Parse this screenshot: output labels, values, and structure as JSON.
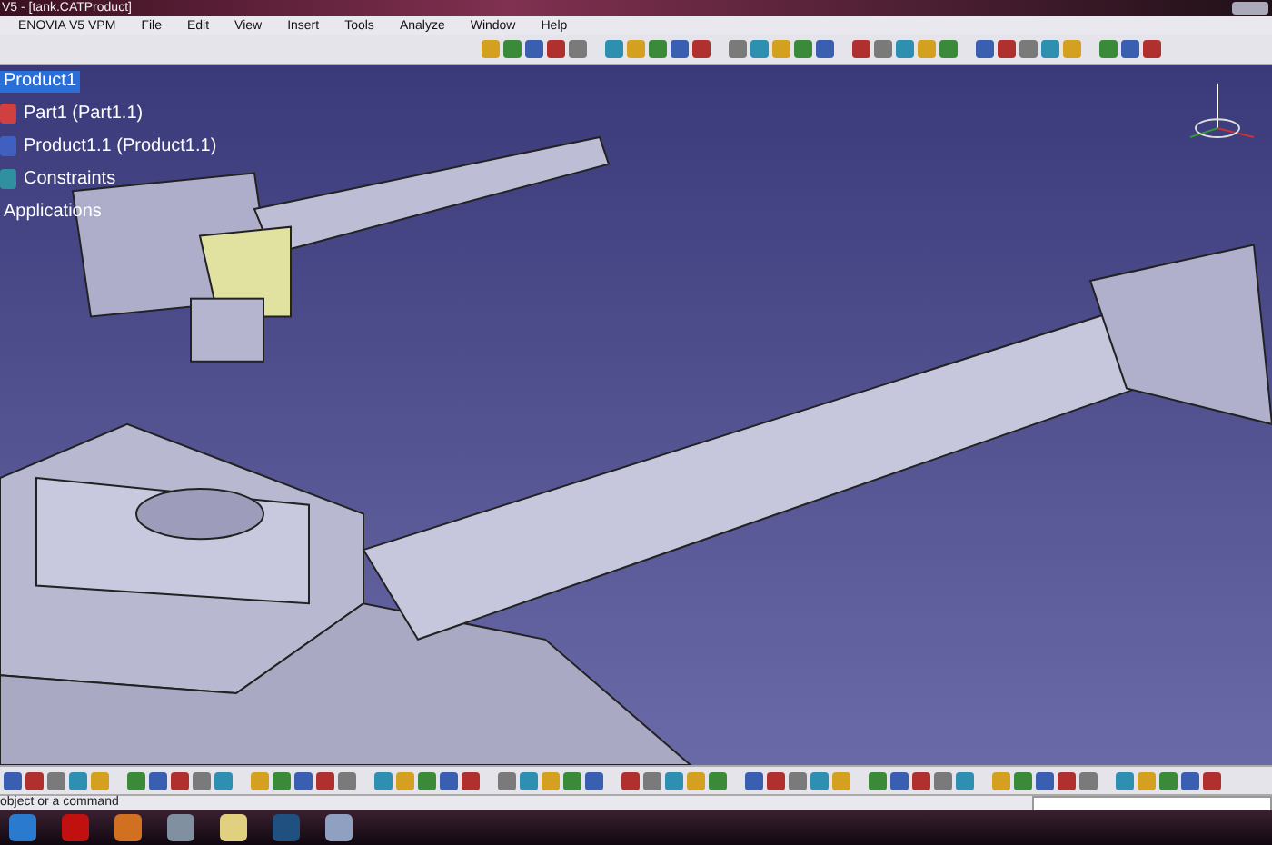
{
  "window": {
    "title": "V5 - [tank.CATProduct]"
  },
  "menu": [
    "ENOVIA V5 VPM",
    "File",
    "Edit",
    "View",
    "Insert",
    "Tools",
    "Analyze",
    "Window",
    "Help"
  ],
  "tree": [
    {
      "label": "Product1",
      "selected": true,
      "kind": "root"
    },
    {
      "label": "Part1 (Part1.1)",
      "selected": false,
      "kind": "part"
    },
    {
      "label": "Product1.1 (Product1.1)",
      "selected": false,
      "kind": "product"
    },
    {
      "label": "Constraints",
      "selected": false,
      "kind": "constraints"
    },
    {
      "label": "Applications",
      "selected": false,
      "kind": "plain"
    }
  ],
  "status_bar": {
    "text": "object or a command"
  }
}
